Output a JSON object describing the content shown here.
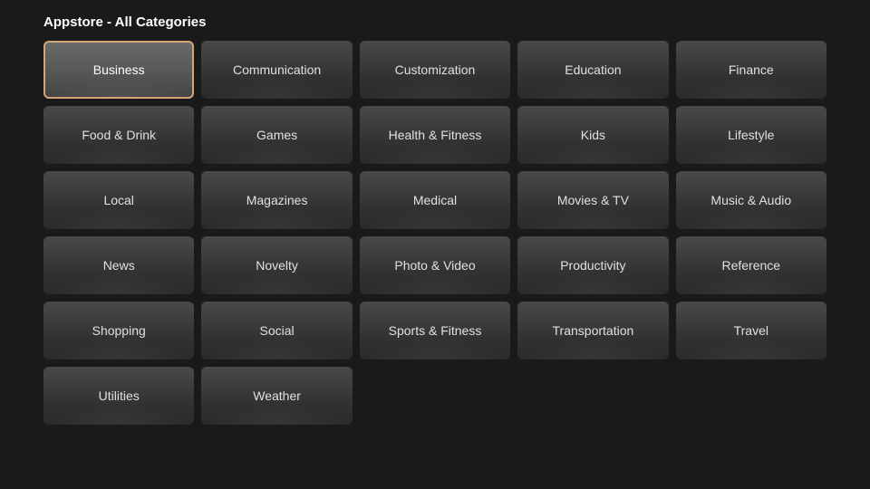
{
  "header": {
    "title": "Appstore - All Categories"
  },
  "categories": [
    {
      "id": "business",
      "label": "Business",
      "selected": true
    },
    {
      "id": "communication",
      "label": "Communication",
      "selected": false
    },
    {
      "id": "customization",
      "label": "Customization",
      "selected": false
    },
    {
      "id": "education",
      "label": "Education",
      "selected": false
    },
    {
      "id": "finance",
      "label": "Finance",
      "selected": false
    },
    {
      "id": "food-drink",
      "label": "Food & Drink",
      "selected": false
    },
    {
      "id": "games",
      "label": "Games",
      "selected": false
    },
    {
      "id": "health-fitness",
      "label": "Health & Fitness",
      "selected": false
    },
    {
      "id": "kids",
      "label": "Kids",
      "selected": false
    },
    {
      "id": "lifestyle",
      "label": "Lifestyle",
      "selected": false
    },
    {
      "id": "local",
      "label": "Local",
      "selected": false
    },
    {
      "id": "magazines",
      "label": "Magazines",
      "selected": false
    },
    {
      "id": "medical",
      "label": "Medical",
      "selected": false
    },
    {
      "id": "movies-tv",
      "label": "Movies & TV",
      "selected": false
    },
    {
      "id": "music-audio",
      "label": "Music & Audio",
      "selected": false
    },
    {
      "id": "news",
      "label": "News",
      "selected": false
    },
    {
      "id": "novelty",
      "label": "Novelty",
      "selected": false
    },
    {
      "id": "photo-video",
      "label": "Photo & Video",
      "selected": false
    },
    {
      "id": "productivity",
      "label": "Productivity",
      "selected": false
    },
    {
      "id": "reference",
      "label": "Reference",
      "selected": false
    },
    {
      "id": "shopping",
      "label": "Shopping",
      "selected": false
    },
    {
      "id": "social",
      "label": "Social",
      "selected": false
    },
    {
      "id": "sports-fitness",
      "label": "Sports & Fitness",
      "selected": false
    },
    {
      "id": "transportation",
      "label": "Transportation",
      "selected": false
    },
    {
      "id": "travel",
      "label": "Travel",
      "selected": false
    },
    {
      "id": "utilities",
      "label": "Utilities",
      "selected": false
    },
    {
      "id": "weather",
      "label": "Weather",
      "selected": false
    }
  ]
}
